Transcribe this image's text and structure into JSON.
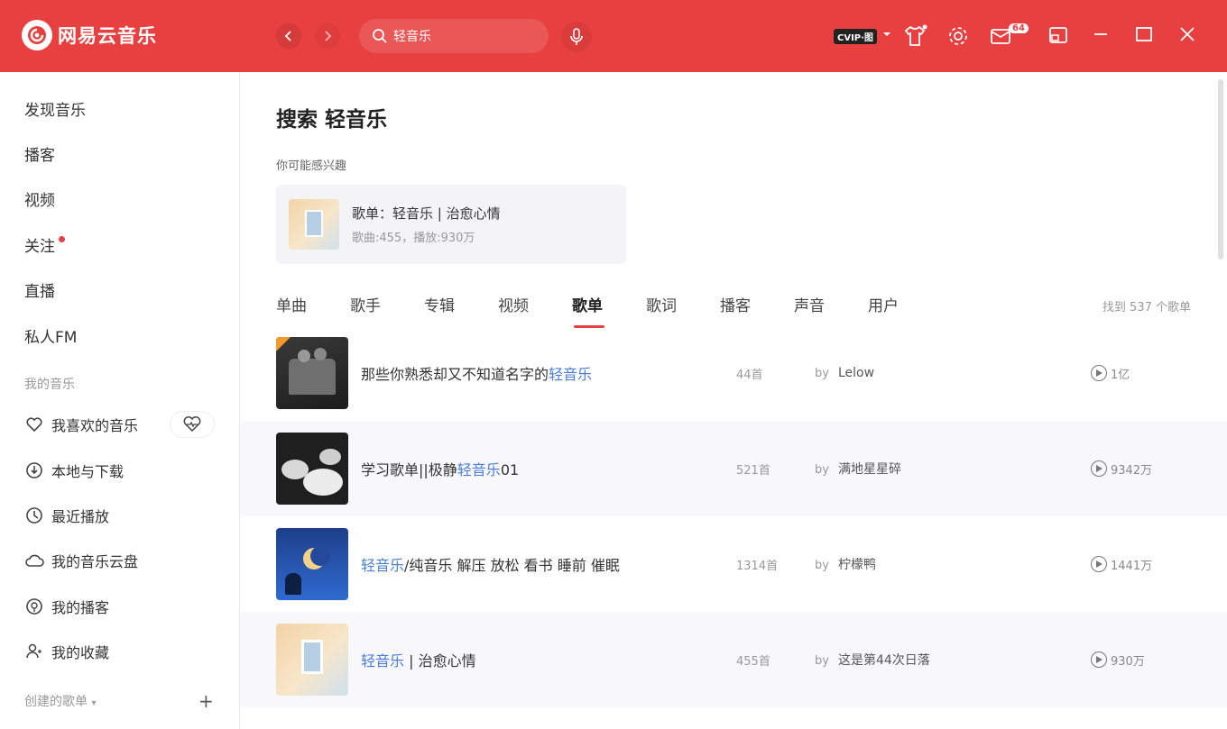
{
  "app": {
    "name": "网易云音乐"
  },
  "search": {
    "value": "轻音乐"
  },
  "titlebar": {
    "vip_label": "CVIP·图",
    "mail_count": "64"
  },
  "sidebar": {
    "items": [
      {
        "label": "发现音乐"
      },
      {
        "label": "播客"
      },
      {
        "label": "视频"
      },
      {
        "label": "关注"
      },
      {
        "label": "直播"
      },
      {
        "label": "私人FM"
      }
    ],
    "my_music_title": "我的音乐",
    "my_items": [
      {
        "label": "我喜欢的音乐",
        "icon": "heart-icon"
      },
      {
        "label": "本地与下载",
        "icon": "download-icon"
      },
      {
        "label": "最近播放",
        "icon": "clock-icon"
      },
      {
        "label": "我的音乐云盘",
        "icon": "cloud-icon"
      },
      {
        "label": "我的播客",
        "icon": "podcast-icon"
      },
      {
        "label": "我的收藏",
        "icon": "collect-icon"
      }
    ],
    "created_title": "创建的歌单"
  },
  "main": {
    "title": "搜索 轻音乐",
    "hint": "你可能感兴趣",
    "suggestion": {
      "title": "歌单：轻音乐 | 治愈心情",
      "sub": "歌曲:455，播放:930万"
    },
    "tabs": [
      {
        "label": "单曲"
      },
      {
        "label": "歌手"
      },
      {
        "label": "专辑"
      },
      {
        "label": "视频"
      },
      {
        "label": "歌单",
        "active": true
      },
      {
        "label": "歌词"
      },
      {
        "label": "播客"
      },
      {
        "label": "声音"
      },
      {
        "label": "用户"
      }
    ],
    "found_text": "找到 537 个歌单",
    "rows": [
      {
        "title_pre": "那些你熟悉却又不知道名字的",
        "title_hl": "轻音乐",
        "title_post": "",
        "count": "44首",
        "by": "by",
        "author": "Lelow",
        "plays": "1亿"
      },
      {
        "title_pre": "学习歌单||极静",
        "title_hl": "轻音乐",
        "title_post": "01",
        "count": "521首",
        "by": "by",
        "author": "满地星星碎",
        "plays": "9342万"
      },
      {
        "title_pre": "",
        "title_hl": "轻音乐",
        "title_post": "/纯音乐 解压 放松 看书 睡前 催眠",
        "count": "1314首",
        "by": "by",
        "author": "柠檬鸭",
        "plays": "1441万"
      },
      {
        "title_pre": "",
        "title_hl": "轻音乐",
        "title_post": " | 治愈心情",
        "count": "455首",
        "by": "by",
        "author": "这是第44次日落",
        "plays": "930万"
      }
    ]
  }
}
